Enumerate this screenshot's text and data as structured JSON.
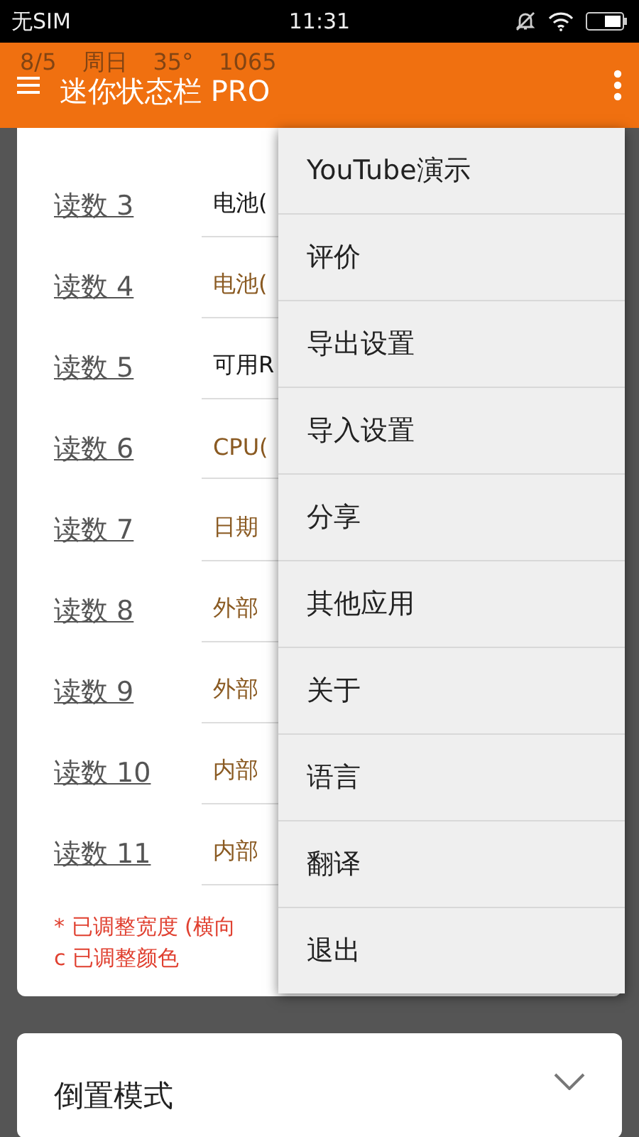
{
  "status_bar": {
    "carrier": "无SIM",
    "time": "11:31"
  },
  "mini_bar": [
    "8/5",
    "周日",
    "35°",
    "1065"
  ],
  "app_bar": {
    "title": "迷你状态栏 PRO"
  },
  "readings": [
    {
      "label": "读数 3",
      "value": "电池(",
      "color": "#1a1a1a"
    },
    {
      "label": "读数 4",
      "value": "电池(",
      "color": "#8a5a22"
    },
    {
      "label": "读数 5",
      "value": "可用R",
      "color": "#1a1a1a"
    },
    {
      "label": "读数 6",
      "value": "CPU(",
      "color": "#8a5a22"
    },
    {
      "label": "读数 7",
      "value": "日期",
      "color": "#8a5a22"
    },
    {
      "label": "读数 8",
      "value": "外部",
      "color": "#8a5a22"
    },
    {
      "label": "读数 9",
      "value": "外部",
      "color": "#8a5a22"
    },
    {
      "label": "读数 10",
      "value": "内部",
      "color": "#8a5a22"
    },
    {
      "label": "读数 11",
      "value": "内部",
      "color": "#8a5a22"
    }
  ],
  "notes": [
    "* 已调整宽度 (横向",
    "c 已调整颜色"
  ],
  "section": {
    "title": "倒置模式"
  },
  "menu": [
    "YouTube演示",
    "评价",
    "导出设置",
    "导入设置",
    "分享",
    "其他应用",
    "关于",
    "语言",
    "翻译",
    "退出"
  ]
}
